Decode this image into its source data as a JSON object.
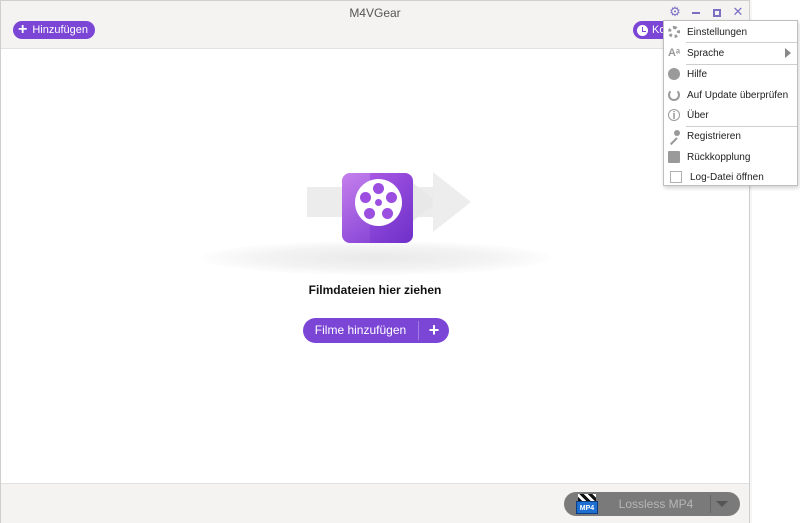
{
  "window": {
    "title": "M4VGear"
  },
  "toolbar": {
    "add_label": "Hinzufügen",
    "history_label": "Kon"
  },
  "drop_area": {
    "hint": "Filmdateien hier ziehen",
    "add_button_label": "Filme hinzufügen",
    "add_button_plus": "+"
  },
  "output": {
    "format_label": "Lossless MP4",
    "format_badge": "MP4"
  },
  "menu": {
    "items": [
      {
        "label": "Einstellungen",
        "icon": "gear-icon"
      },
      {
        "label": "Sprache",
        "icon": "language-icon"
      },
      {
        "label": "Hilfe",
        "icon": "help-icon"
      },
      {
        "label": "Auf Update überprüfen",
        "icon": "refresh-icon"
      },
      {
        "label": "Über",
        "icon": "info-icon"
      },
      {
        "label": "Registrieren",
        "icon": "key-icon"
      },
      {
        "label": "Rückkopplung",
        "icon": "feedback-icon"
      },
      {
        "label": "Log-Datei öffnen",
        "icon": "log-file-icon"
      }
    ]
  },
  "colors": {
    "accent": "#7b45d6",
    "titlebar": "#f4f3f2",
    "format_pill": "#7a7a7a"
  }
}
